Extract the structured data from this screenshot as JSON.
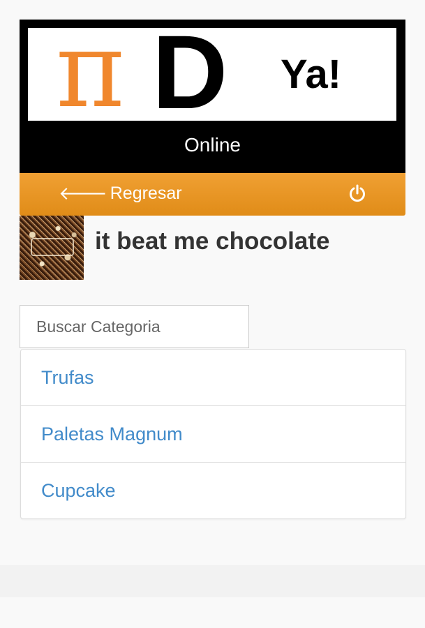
{
  "header": {
    "logo": {
      "pi": "π",
      "letter": "D",
      "suffix": "Ya!"
    },
    "status": "Online",
    "colors": {
      "accent_orange": "#f0872d",
      "nav_orange": "#e8931f",
      "link_blue": "#428bca"
    }
  },
  "nav": {
    "back_icon": "arrow-left-icon",
    "back_label": "Regresar",
    "power_icon": "power-icon"
  },
  "store": {
    "name": "it beat me chocolate"
  },
  "search": {
    "placeholder": "Buscar Categoria"
  },
  "categories": [
    {
      "label": "Trufas"
    },
    {
      "label": "Paletas Magnum"
    },
    {
      "label": "Cupcake"
    }
  ]
}
